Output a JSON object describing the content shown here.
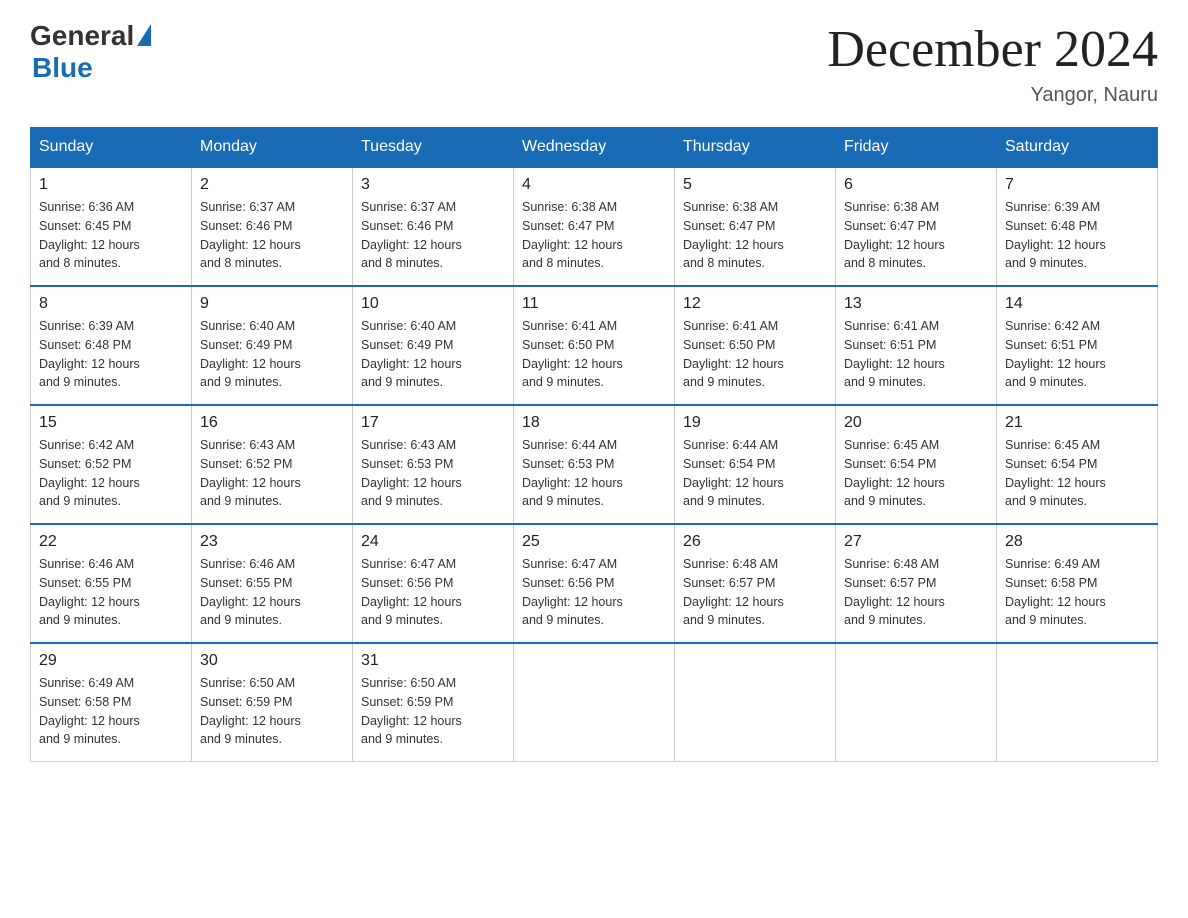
{
  "header": {
    "logo_general": "General",
    "logo_blue": "Blue",
    "month_title": "December 2024",
    "location": "Yangor, Nauru"
  },
  "weekdays": [
    "Sunday",
    "Monday",
    "Tuesday",
    "Wednesday",
    "Thursday",
    "Friday",
    "Saturday"
  ],
  "weeks": [
    [
      {
        "day": "1",
        "sunrise": "6:36 AM",
        "sunset": "6:45 PM",
        "daylight": "12 hours and 8 minutes."
      },
      {
        "day": "2",
        "sunrise": "6:37 AM",
        "sunset": "6:46 PM",
        "daylight": "12 hours and 8 minutes."
      },
      {
        "day": "3",
        "sunrise": "6:37 AM",
        "sunset": "6:46 PM",
        "daylight": "12 hours and 8 minutes."
      },
      {
        "day": "4",
        "sunrise": "6:38 AM",
        "sunset": "6:47 PM",
        "daylight": "12 hours and 8 minutes."
      },
      {
        "day": "5",
        "sunrise": "6:38 AM",
        "sunset": "6:47 PM",
        "daylight": "12 hours and 8 minutes."
      },
      {
        "day": "6",
        "sunrise": "6:38 AM",
        "sunset": "6:47 PM",
        "daylight": "12 hours and 8 minutes."
      },
      {
        "day": "7",
        "sunrise": "6:39 AM",
        "sunset": "6:48 PM",
        "daylight": "12 hours and 9 minutes."
      }
    ],
    [
      {
        "day": "8",
        "sunrise": "6:39 AM",
        "sunset": "6:48 PM",
        "daylight": "12 hours and 9 minutes."
      },
      {
        "day": "9",
        "sunrise": "6:40 AM",
        "sunset": "6:49 PM",
        "daylight": "12 hours and 9 minutes."
      },
      {
        "day": "10",
        "sunrise": "6:40 AM",
        "sunset": "6:49 PM",
        "daylight": "12 hours and 9 minutes."
      },
      {
        "day": "11",
        "sunrise": "6:41 AM",
        "sunset": "6:50 PM",
        "daylight": "12 hours and 9 minutes."
      },
      {
        "day": "12",
        "sunrise": "6:41 AM",
        "sunset": "6:50 PM",
        "daylight": "12 hours and 9 minutes."
      },
      {
        "day": "13",
        "sunrise": "6:41 AM",
        "sunset": "6:51 PM",
        "daylight": "12 hours and 9 minutes."
      },
      {
        "day": "14",
        "sunrise": "6:42 AM",
        "sunset": "6:51 PM",
        "daylight": "12 hours and 9 minutes."
      }
    ],
    [
      {
        "day": "15",
        "sunrise": "6:42 AM",
        "sunset": "6:52 PM",
        "daylight": "12 hours and 9 minutes."
      },
      {
        "day": "16",
        "sunrise": "6:43 AM",
        "sunset": "6:52 PM",
        "daylight": "12 hours and 9 minutes."
      },
      {
        "day": "17",
        "sunrise": "6:43 AM",
        "sunset": "6:53 PM",
        "daylight": "12 hours and 9 minutes."
      },
      {
        "day": "18",
        "sunrise": "6:44 AM",
        "sunset": "6:53 PM",
        "daylight": "12 hours and 9 minutes."
      },
      {
        "day": "19",
        "sunrise": "6:44 AM",
        "sunset": "6:54 PM",
        "daylight": "12 hours and 9 minutes."
      },
      {
        "day": "20",
        "sunrise": "6:45 AM",
        "sunset": "6:54 PM",
        "daylight": "12 hours and 9 minutes."
      },
      {
        "day": "21",
        "sunrise": "6:45 AM",
        "sunset": "6:54 PM",
        "daylight": "12 hours and 9 minutes."
      }
    ],
    [
      {
        "day": "22",
        "sunrise": "6:46 AM",
        "sunset": "6:55 PM",
        "daylight": "12 hours and 9 minutes."
      },
      {
        "day": "23",
        "sunrise": "6:46 AM",
        "sunset": "6:55 PM",
        "daylight": "12 hours and 9 minutes."
      },
      {
        "day": "24",
        "sunrise": "6:47 AM",
        "sunset": "6:56 PM",
        "daylight": "12 hours and 9 minutes."
      },
      {
        "day": "25",
        "sunrise": "6:47 AM",
        "sunset": "6:56 PM",
        "daylight": "12 hours and 9 minutes."
      },
      {
        "day": "26",
        "sunrise": "6:48 AM",
        "sunset": "6:57 PM",
        "daylight": "12 hours and 9 minutes."
      },
      {
        "day": "27",
        "sunrise": "6:48 AM",
        "sunset": "6:57 PM",
        "daylight": "12 hours and 9 minutes."
      },
      {
        "day": "28",
        "sunrise": "6:49 AM",
        "sunset": "6:58 PM",
        "daylight": "12 hours and 9 minutes."
      }
    ],
    [
      {
        "day": "29",
        "sunrise": "6:49 AM",
        "sunset": "6:58 PM",
        "daylight": "12 hours and 9 minutes."
      },
      {
        "day": "30",
        "sunrise": "6:50 AM",
        "sunset": "6:59 PM",
        "daylight": "12 hours and 9 minutes."
      },
      {
        "day": "31",
        "sunrise": "6:50 AM",
        "sunset": "6:59 PM",
        "daylight": "12 hours and 9 minutes."
      },
      null,
      null,
      null,
      null
    ]
  ],
  "labels": {
    "sunrise": "Sunrise:",
    "sunset": "Sunset:",
    "daylight": "Daylight:"
  }
}
